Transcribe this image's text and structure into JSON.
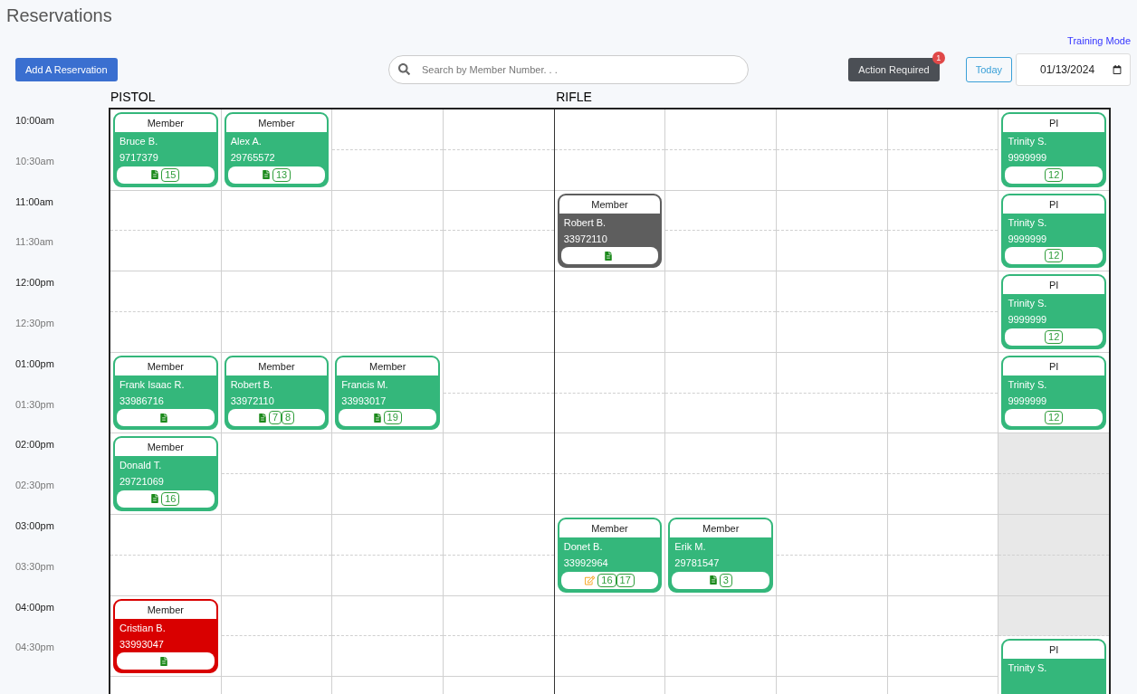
{
  "title": "Reservations",
  "training_link": "Training Mode",
  "add_button": "Add A Reservation",
  "search": {
    "placeholder": "Search by Member Number. . ."
  },
  "action_button": {
    "label": "Action Required",
    "badge": "1"
  },
  "today_button": "Today",
  "date": "01/13/2024",
  "times": [
    {
      "label": "10:00am",
      "kind": "hour"
    },
    {
      "label": "10:30am",
      "kind": "half"
    },
    {
      "label": "11:00am",
      "kind": "hour"
    },
    {
      "label": "11:30am",
      "kind": "half"
    },
    {
      "label": "12:00pm",
      "kind": "hour"
    },
    {
      "label": "12:30pm",
      "kind": "half"
    },
    {
      "label": "01:00pm",
      "kind": "hour"
    },
    {
      "label": "01:30pm",
      "kind": "half"
    },
    {
      "label": "02:00pm",
      "kind": "hour"
    },
    {
      "label": "02:30pm",
      "kind": "half"
    },
    {
      "label": "03:00pm",
      "kind": "hour"
    },
    {
      "label": "03:30pm",
      "kind": "half"
    },
    {
      "label": "04:00pm",
      "kind": "hour"
    },
    {
      "label": "04:30pm",
      "kind": "half"
    }
  ],
  "groups": [
    {
      "label": "PISTOL",
      "lanes": [
        {
          "items": [
            {
              "kind": "booking",
              "role": "Member",
              "name": "Bruce B.",
              "number": "9717379",
              "color": "#34b77b",
              "icons": [
                {
                  "kind": "doc"
                }
              ],
              "badges": [
                "15"
              ]
            },
            {
              "kind": "open"
            },
            {
              "kind": "open"
            },
            {
              "kind": "open"
            },
            {
              "kind": "open"
            },
            {
              "kind": "booking",
              "role": "Member",
              "name": "Frank Isaac R.",
              "number": "33986716",
              "color": "#34b77b",
              "icons": [
                {
                  "kind": "doc"
                }
              ]
            },
            {
              "kind": "booking",
              "role": "Member",
              "name": "Donald T.",
              "number": "29721069",
              "color": "#34b77b",
              "icons": [
                {
                  "kind": "doc"
                }
              ],
              "badges": [
                "16"
              ]
            },
            {
              "kind": "open"
            },
            {
              "kind": "open"
            },
            {
              "kind": "booking",
              "role": "Member",
              "name": "Cristian B.",
              "number": "33993047",
              "color": "#d90000",
              "icons": [
                {
                  "kind": "doc"
                }
              ]
            }
          ]
        },
        {
          "items": [
            {
              "kind": "booking",
              "role": "Member",
              "name": "Alex A.",
              "number": "29765572",
              "color": "#34b77b",
              "icons": [
                {
                  "kind": "doc"
                }
              ],
              "badges": [
                "13"
              ]
            },
            {
              "kind": "open"
            },
            {
              "kind": "open"
            },
            {
              "kind": "open"
            },
            {
              "kind": "open"
            },
            {
              "kind": "booking",
              "role": "Member",
              "name": "Robert B.",
              "number": "33972110",
              "color": "#34b77b",
              "icons": [
                {
                  "kind": "doc"
                }
              ],
              "badges": [
                "7",
                "8"
              ]
            },
            {
              "kind": "open"
            },
            {
              "kind": "open"
            },
            {
              "kind": "open"
            },
            {
              "kind": "open"
            },
            {
              "kind": "open"
            },
            {
              "kind": "open"
            }
          ]
        },
        {
          "items": [
            {
              "kind": "open"
            },
            {
              "kind": "open"
            },
            {
              "kind": "open"
            },
            {
              "kind": "open"
            },
            {
              "kind": "open"
            },
            {
              "kind": "open"
            },
            {
              "kind": "booking",
              "role": "Member",
              "name": "Francis M.",
              "number": "33993017",
              "color": "#34b77b",
              "icons": [
                {
                  "kind": "doc"
                }
              ],
              "badges": [
                "19"
              ]
            },
            {
              "kind": "open"
            },
            {
              "kind": "open"
            },
            {
              "kind": "open"
            },
            {
              "kind": "open"
            },
            {
              "kind": "open"
            },
            {
              "kind": "open"
            }
          ]
        },
        {
          "items": [
            {
              "kind": "open"
            },
            {
              "kind": "open"
            },
            {
              "kind": "open"
            },
            {
              "kind": "open"
            },
            {
              "kind": "open"
            },
            {
              "kind": "open"
            },
            {
              "kind": "open"
            },
            {
              "kind": "open"
            },
            {
              "kind": "open"
            },
            {
              "kind": "open"
            },
            {
              "kind": "open"
            },
            {
              "kind": "open"
            },
            {
              "kind": "open"
            },
            {
              "kind": "open"
            }
          ]
        }
      ]
    },
    {
      "label": "RIFLE",
      "lanes": [
        {
          "items": [
            {
              "kind": "open"
            },
            {
              "kind": "open"
            },
            {
              "kind": "booking",
              "role": "Member",
              "name": "Robert B.",
              "number": "33972110",
              "color": "#5e5e5e",
              "icons": [
                {
                  "kind": "doc"
                }
              ]
            },
            {
              "kind": "open"
            },
            {
              "kind": "open"
            },
            {
              "kind": "open"
            },
            {
              "kind": "open"
            },
            {
              "kind": "open"
            },
            {
              "kind": "open"
            },
            {
              "kind": "booking",
              "role": "Member",
              "name": "Donet B.",
              "number": "33992964",
              "color": "#34b77b",
              "icons": [
                {
                  "kind": "edit"
                }
              ],
              "badges": [
                "16",
                "17"
              ]
            },
            {
              "kind": "open"
            },
            {
              "kind": "open"
            }
          ]
        },
        {
          "items": [
            {
              "kind": "open"
            },
            {
              "kind": "open"
            },
            {
              "kind": "open"
            },
            {
              "kind": "open"
            },
            {
              "kind": "open"
            },
            {
              "kind": "open"
            },
            {
              "kind": "open"
            },
            {
              "kind": "open"
            },
            {
              "kind": "open"
            },
            {
              "kind": "open"
            },
            {
              "kind": "booking",
              "role": "Member",
              "name": "Erik M.",
              "number": "29781547",
              "color": "#34b77b",
              "icons": [
                {
                  "kind": "doc"
                }
              ],
              "badges": [
                "3"
              ]
            },
            {
              "kind": "open"
            },
            {
              "kind": "open"
            }
          ]
        },
        {
          "items": [
            {
              "kind": "open"
            },
            {
              "kind": "open"
            },
            {
              "kind": "open"
            },
            {
              "kind": "open"
            },
            {
              "kind": "open"
            },
            {
              "kind": "open"
            },
            {
              "kind": "open"
            },
            {
              "kind": "open"
            },
            {
              "kind": "open"
            },
            {
              "kind": "open"
            },
            {
              "kind": "open"
            },
            {
              "kind": "open"
            },
            {
              "kind": "open"
            },
            {
              "kind": "open"
            }
          ]
        },
        {
          "items": [
            {
              "kind": "open"
            },
            {
              "kind": "open"
            },
            {
              "kind": "open"
            },
            {
              "kind": "open"
            },
            {
              "kind": "open"
            },
            {
              "kind": "open"
            },
            {
              "kind": "open"
            },
            {
              "kind": "open"
            },
            {
              "kind": "open"
            },
            {
              "kind": "open"
            },
            {
              "kind": "open"
            },
            {
              "kind": "open"
            },
            {
              "kind": "open"
            },
            {
              "kind": "open"
            }
          ]
        },
        {
          "items": [
            {
              "kind": "booking",
              "role": "PI",
              "name": "Trinity S.",
              "number": "9999999",
              "color": "#34b77b",
              "badges": [
                "12"
              ]
            },
            {
              "kind": "booking",
              "role": "PI",
              "name": "Trinity S.",
              "number": "9999999",
              "color": "#34b77b",
              "badges": [
                "12"
              ]
            },
            {
              "kind": "booking",
              "role": "PI",
              "name": "Trinity S.",
              "number": "9999999",
              "color": "#34b77b",
              "badges": [
                "12"
              ]
            },
            {
              "kind": "booking",
              "role": "PI",
              "name": "Trinity S.",
              "number": "9999999",
              "color": "#34b77b",
              "badges": [
                "12"
              ]
            },
            {
              "kind": "closed"
            },
            {
              "kind": "closed"
            },
            {
              "kind": "closed"
            },
            {
              "kind": "closed"
            },
            {
              "kind": "closed"
            },
            {
              "kind": "booking",
              "role": "PI",
              "name": "Trinity S.",
              "color": "#34b77b"
            }
          ]
        }
      ]
    }
  ]
}
